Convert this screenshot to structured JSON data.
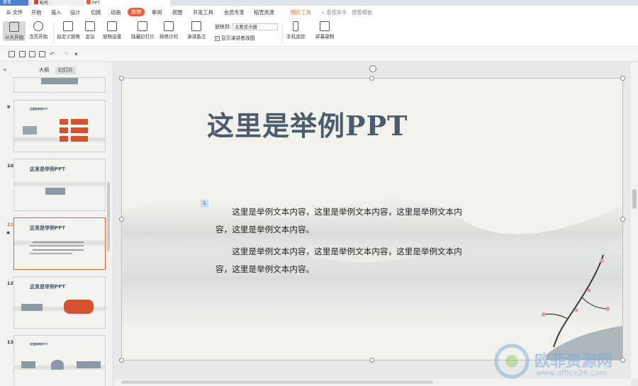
{
  "tabs": {
    "home_label": "首页",
    "doc1_label": "稻壳",
    "doc2_label": "PPT"
  },
  "menu": {
    "hamburger_label": "☰ 文件",
    "items": [
      "开始",
      "插入",
      "设计",
      "切换",
      "动画",
      "放映",
      "审阅",
      "视图",
      "开发工具",
      "会员专享",
      "稻壳资源"
    ],
    "picture_tools": "图片工具",
    "search_placeholder": "查找命令、搜索模板"
  },
  "ribbon": {
    "from_start": "从头开始",
    "from_current": "当页开始",
    "custom_show": "自定义放映",
    "meeting": "会议",
    "show_settings": "放映设置",
    "hide_slide": "隐藏幻灯片",
    "rehearse": "排练计时",
    "speaker_notes": "演讲备注",
    "show_on_label": "放映到:",
    "show_on_value": "主要显示器",
    "presenter_view": "显示演讲者视图",
    "presenter_checked": "✓",
    "phone_remote": "手机遥控",
    "screen_record": "屏幕录制"
  },
  "sidebar": {
    "collapse_icon": "«",
    "tab_outline": "大纲",
    "tab_slides": "幻灯片",
    "thumbs": [
      {
        "num": "9",
        "title": "这里是举例PPT"
      },
      {
        "num": "10",
        "title": "这里是举例PPT"
      },
      {
        "num": "11",
        "title": "这里是举例PPT",
        "star": "✱"
      },
      {
        "num": "12",
        "title": "这里是举例PPT"
      },
      {
        "num": "13",
        "title": "这里是举例PPT"
      }
    ]
  },
  "slide": {
    "title": "这里是举例PPT",
    "placeholder_tag": "1",
    "paragraph1": "　　这里是举例文本内容，这里是举例文本内容，这里是举例文本内容，这里是举例文本内容。",
    "paragraph2": "　　这里是举例文本内容，这里是举例文本内容，这里是举例文本内容，这里是举例文本内容。"
  },
  "watermark": {
    "text": "欧菲资源网",
    "url": "www.office26.com"
  },
  "colors": {
    "accent": "#f55a36",
    "selected_border": "#e0653c",
    "title_color": "#4a5c6e"
  }
}
